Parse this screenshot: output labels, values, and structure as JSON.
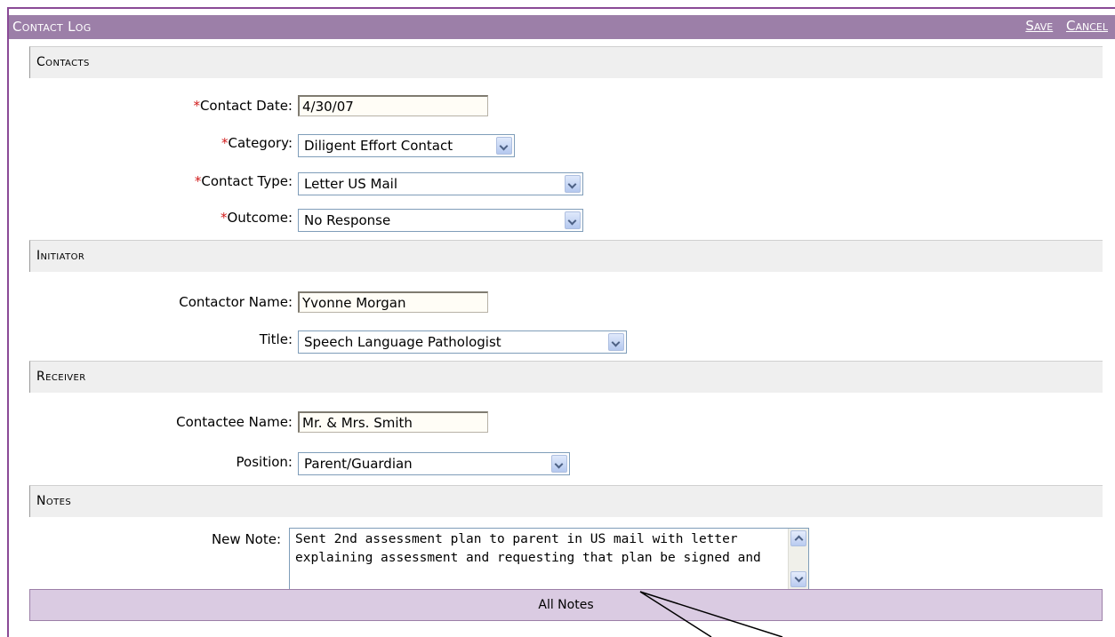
{
  "header": {
    "title": "Contact Log",
    "save_label": "Save",
    "cancel_label": "Cancel"
  },
  "contacts": {
    "section_title": "Contacts",
    "contact_date_label": "Contact Date:",
    "contact_date_value": "4/30/07",
    "category_label": "Category:",
    "category_value": "Diligent Effort Contact",
    "contact_type_label": "Contact Type:",
    "contact_type_value": "Letter US Mail",
    "outcome_label": "Outcome:",
    "outcome_value": "No Response",
    "required_marker": "*"
  },
  "initiator": {
    "section_title": "Initiator",
    "contactor_name_label": "Contactor Name:",
    "contactor_name_value": "Yvonne Morgan",
    "title_label": "Title:",
    "title_value": "Speech Language Pathologist"
  },
  "receiver": {
    "section_title": "Receiver",
    "contactee_name_label": "Contactee Name:",
    "contactee_name_value": "Mr. & Mrs. Smith",
    "position_label": "Position:",
    "position_value": "Parent/Guardian"
  },
  "notes": {
    "section_title": "Notes",
    "new_note_label": "New Note:",
    "new_note_value": "Sent 2nd assessment plan to parent in US mail with letter explaining assessment and requesting that plan be signed and",
    "all_notes_label": "All Notes"
  }
}
